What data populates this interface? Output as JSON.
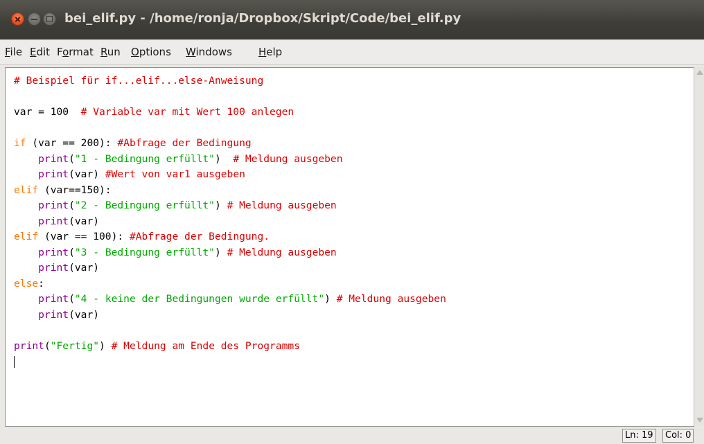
{
  "window": {
    "title": "bei_elif.py - /home/ronja/Dropbox/Skript/Code/bei_elif.py"
  },
  "menu": {
    "items": [
      {
        "label": "File",
        "mnemonic": "F",
        "rest": "ile"
      },
      {
        "label": "Edit",
        "mnemonic": "E",
        "rest": "dit"
      },
      {
        "label": "Format",
        "pre": "F",
        "mnemonic": "o",
        "rest": "rmat"
      },
      {
        "label": "Run",
        "mnemonic": "R",
        "rest": "un"
      },
      {
        "label": "Options",
        "mnemonic": "O",
        "rest": "ptions"
      },
      {
        "label": "Windows",
        "mnemonic": "W",
        "rest": "indows"
      },
      {
        "label": "Help",
        "mnemonic": "H",
        "rest": "elp"
      }
    ]
  },
  "editor": {
    "lines": [
      [
        {
          "t": "# Beispiel für if...elif...else-Anweisung",
          "c": "c"
        }
      ],
      [],
      [
        {
          "t": "var = 100  ",
          "c": ""
        },
        {
          "t": "# Variable var mit Wert 100 anlegen",
          "c": "c"
        }
      ],
      [],
      [
        {
          "t": "if",
          "c": "k"
        },
        {
          "t": " (var == 200): ",
          "c": ""
        },
        {
          "t": "#Abfrage der Bedingung",
          "c": "c"
        }
      ],
      [
        {
          "t": "    ",
          "c": ""
        },
        {
          "t": "print",
          "c": "b"
        },
        {
          "t": "(",
          "c": ""
        },
        {
          "t": "\"1 - Bedingung erfüllt\"",
          "c": "s"
        },
        {
          "t": ")  ",
          "c": ""
        },
        {
          "t": "# Meldung ausgeben",
          "c": "c"
        }
      ],
      [
        {
          "t": "    ",
          "c": ""
        },
        {
          "t": "print",
          "c": "b"
        },
        {
          "t": "(var) ",
          "c": ""
        },
        {
          "t": "#Wert von var1 ausgeben",
          "c": "c"
        }
      ],
      [
        {
          "t": "elif",
          "c": "k"
        },
        {
          "t": " (var==150):",
          "c": ""
        }
      ],
      [
        {
          "t": "    ",
          "c": ""
        },
        {
          "t": "print",
          "c": "b"
        },
        {
          "t": "(",
          "c": ""
        },
        {
          "t": "\"2 - Bedingung erfüllt\"",
          "c": "s"
        },
        {
          "t": ") ",
          "c": ""
        },
        {
          "t": "# Meldung ausgeben",
          "c": "c"
        }
      ],
      [
        {
          "t": "    ",
          "c": ""
        },
        {
          "t": "print",
          "c": "b"
        },
        {
          "t": "(var)",
          "c": ""
        }
      ],
      [
        {
          "t": "elif",
          "c": "k"
        },
        {
          "t": " (var == 100): ",
          "c": ""
        },
        {
          "t": "#Abfrage der Bedingung.",
          "c": "c"
        }
      ],
      [
        {
          "t": "    ",
          "c": ""
        },
        {
          "t": "print",
          "c": "b"
        },
        {
          "t": "(",
          "c": ""
        },
        {
          "t": "\"3 - Bedingung erfüllt\"",
          "c": "s"
        },
        {
          "t": ") ",
          "c": ""
        },
        {
          "t": "# Meldung ausgeben",
          "c": "c"
        }
      ],
      [
        {
          "t": "    ",
          "c": ""
        },
        {
          "t": "print",
          "c": "b"
        },
        {
          "t": "(var)",
          "c": ""
        }
      ],
      [
        {
          "t": "else",
          "c": "k"
        },
        {
          "t": ":",
          "c": ""
        }
      ],
      [
        {
          "t": "    ",
          "c": ""
        },
        {
          "t": "print",
          "c": "b"
        },
        {
          "t": "(",
          "c": ""
        },
        {
          "t": "\"4 - keine der Bedingungen wurde erfüllt\"",
          "c": "s"
        },
        {
          "t": ") ",
          "c": ""
        },
        {
          "t": "# Meldung ausgeben",
          "c": "c"
        }
      ],
      [
        {
          "t": "    ",
          "c": ""
        },
        {
          "t": "print",
          "c": "b"
        },
        {
          "t": "(var)",
          "c": ""
        }
      ],
      [],
      [
        {
          "t": "print",
          "c": "b"
        },
        {
          "t": "(",
          "c": ""
        },
        {
          "t": "\"Fertig\"",
          "c": "s"
        },
        {
          "t": ") ",
          "c": ""
        },
        {
          "t": "# Meldung am Ende des Programms",
          "c": "c"
        }
      ],
      []
    ]
  },
  "colors": {
    "comment": "#dd0000",
    "keyword": "#ff7700",
    "string": "#00aa00",
    "builtin": "#900090",
    "titlebar": "#3e3d38"
  },
  "status": {
    "ln": "Ln: 19",
    "col": "Col: 0"
  }
}
